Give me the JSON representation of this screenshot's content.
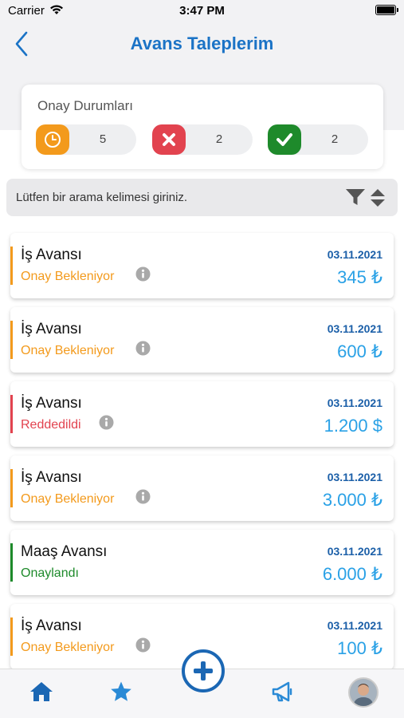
{
  "status_bar": {
    "carrier": "Carrier",
    "time": "3:47 PM"
  },
  "nav": {
    "title": "Avans Taleplerim"
  },
  "summary": {
    "title": "Onay Durumları",
    "pending": {
      "count": "5",
      "color": "#f39a1c"
    },
    "rejected": {
      "count": "2",
      "color": "#e2434f"
    },
    "approved": {
      "count": "2",
      "color": "#1e8a2b"
    }
  },
  "search": {
    "placeholder": "Lütfen bir arama kelimesi giriniz."
  },
  "items": [
    {
      "title": "İş Avansı",
      "status": "Onay Bekleniyor",
      "date": "03.11.2021",
      "amount": "345 ₺",
      "color": "#f39a1c"
    },
    {
      "title": "İş Avansı",
      "status": "Onay Bekleniyor",
      "date": "03.11.2021",
      "amount": "600 ₺",
      "color": "#f39a1c"
    },
    {
      "title": "İş Avansı",
      "status": "Reddedildi",
      "date": "03.11.2021",
      "amount": "1.200 $",
      "color": "#e2434f"
    },
    {
      "title": "İş Avansı",
      "status": "Onay Bekleniyor",
      "date": "03.11.2021",
      "amount": "3.000 ₺",
      "color": "#f39a1c"
    },
    {
      "title": "Maaş Avansı",
      "status": "Onaylandı",
      "date": "03.11.2021",
      "amount": "6.000 ₺",
      "color": "#1e8a2b"
    },
    {
      "title": "İş Avansı",
      "status": "Onay Bekleniyor",
      "date": "03.11.2021",
      "amount": "100 ₺",
      "color": "#f39a1c"
    }
  ],
  "tabs": [
    "home-icon",
    "star-icon",
    "add-icon",
    "megaphone-icon",
    "avatar"
  ]
}
